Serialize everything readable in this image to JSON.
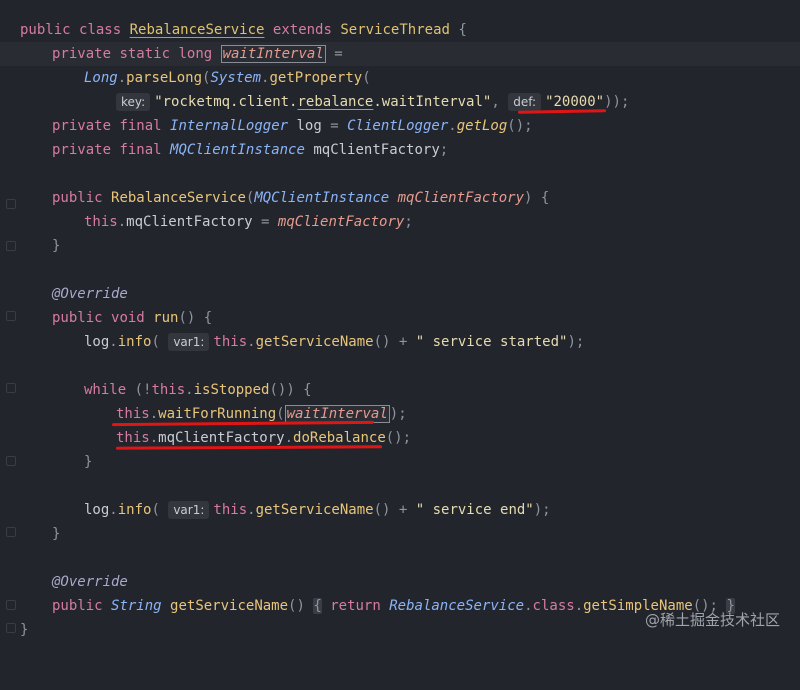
{
  "code": {
    "l1": {
      "kw1": "public",
      "kw2": "class",
      "name": "RebalanceService",
      "kw3": "extends",
      "parent": "ServiceThread",
      "brace": "{"
    },
    "l2": {
      "kw1": "private",
      "kw2": "static",
      "kw3": "long",
      "name": "waitInterval",
      "eq": "="
    },
    "l3": {
      "cls": "Long",
      "dot": ".",
      "fn": "parseLong",
      "p1": "(",
      "sys": "System",
      "dot2": ".",
      "fn2": "getProperty",
      "p2": "("
    },
    "l4": {
      "hint_key": "key:",
      "s1": "\"rocketmq.client.",
      "s2": "rebalance",
      "s3": ".waitInterval\"",
      "comma": ",",
      "hint_def": "def:",
      "val": "\"20000\"",
      "end": "));"
    },
    "l5": {
      "kw1": "private",
      "kw2": "final",
      "type": "InternalLogger",
      "var": "log",
      "eq": "=",
      "cls": "ClientLogger",
      "fn": "getLog",
      "end": "();"
    },
    "l6": {
      "kw1": "private",
      "kw2": "final",
      "type": "MQClientInstance",
      "var": "mqClientFactory",
      "end": ";"
    },
    "l8": {
      "kw1": "public",
      "name": "RebalanceService",
      "p1": "(",
      "type": "MQClientInstance",
      "param": "mqClientFactory",
      "end": ") {"
    },
    "l9": {
      "kw": "this",
      "dot": ".",
      "field": "mqClientFactory",
      "eq": "=",
      "param": "mqClientFactory",
      "end": ";"
    },
    "l10": {
      "brace": "}"
    },
    "l12": {
      "ann": "@Override"
    },
    "l13": {
      "kw1": "public",
      "kw2": "void",
      "fn": "run",
      "end": "() {"
    },
    "l14": {
      "var": "log",
      "dot": ".",
      "fn": "info",
      "p1": "(",
      "hint": "var1:",
      "kw": "this",
      "fn2": "getServiceName",
      "mid": "() +",
      "str": "\" service started\"",
      "end": ");"
    },
    "l16": {
      "kw": "while",
      "p1": "(!",
      "kw2": "this",
      "fn": "isStopped",
      "end": "()) {"
    },
    "l17": {
      "kw": "this",
      "fn": "waitForRunning",
      "p1": "(",
      "arg": "waitInterval",
      "end": ");"
    },
    "l18": {
      "kw": "this",
      "field": "mqClientFactory",
      "fn": "doRebalance",
      "end": "();"
    },
    "l19": {
      "brace": "}"
    },
    "l21": {
      "var": "log",
      "dot": ".",
      "fn": "info",
      "p1": "(",
      "hint": "var1:",
      "kw": "this",
      "fn2": "getServiceName",
      "mid": "() +",
      "str": "\" service end\"",
      "end": ");"
    },
    "l22": {
      "brace": "}"
    },
    "l24": {
      "ann": "@Override"
    },
    "l25": {
      "kw1": "public",
      "type": "String",
      "fn": "getServiceName",
      "p1": "()",
      "b1": "{",
      "kw2": "return",
      "cls": "RebalanceService",
      "kw3": "class",
      "fn2": "getSimpleName",
      "end": "();",
      "b2": "}"
    },
    "l26": {
      "brace": "}"
    }
  },
  "watermark": "@稀土掘金技术社区"
}
